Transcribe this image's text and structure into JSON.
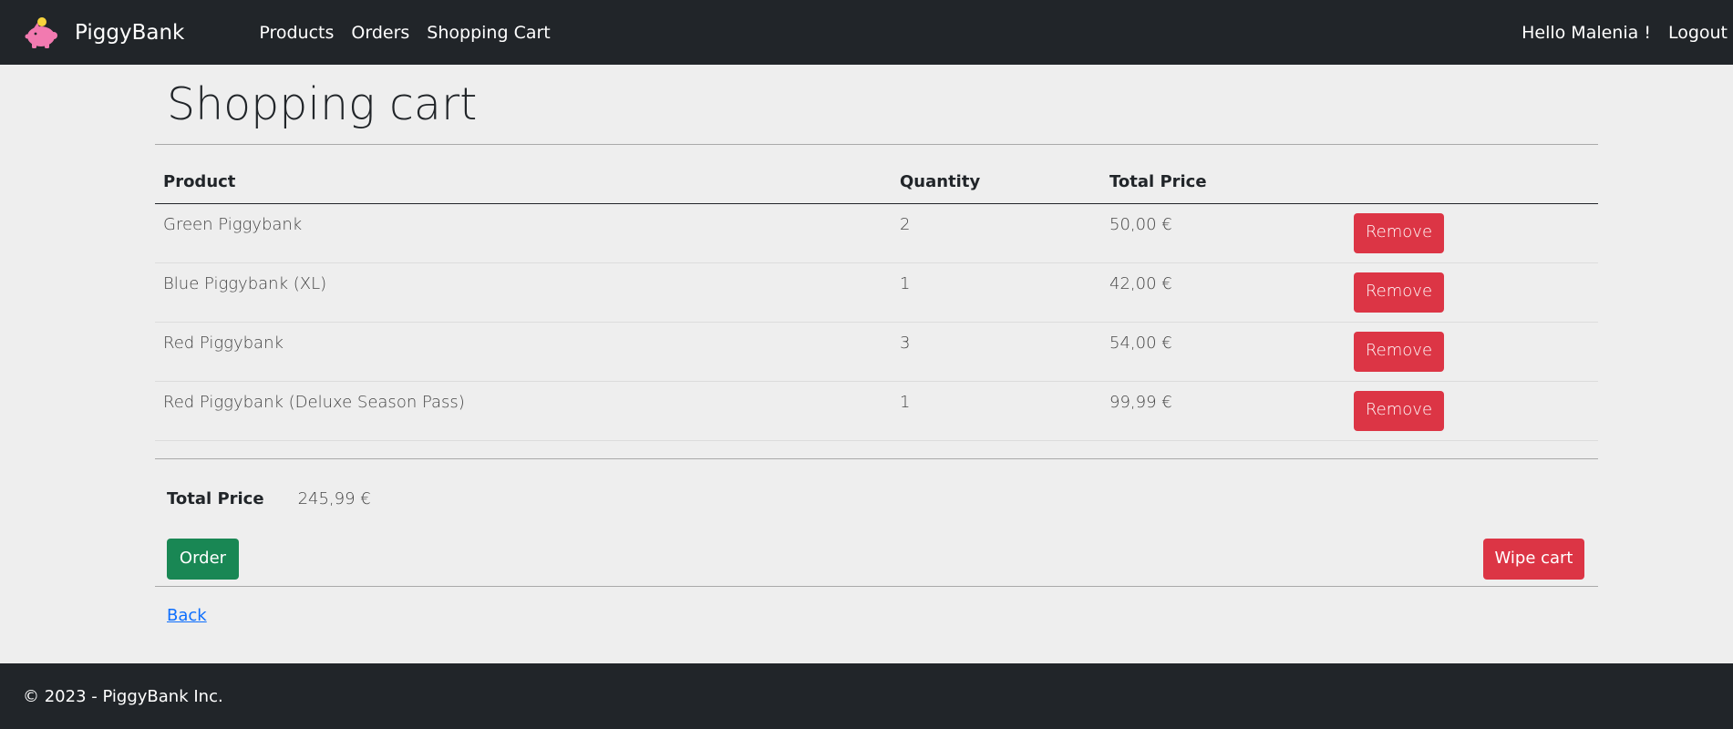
{
  "nav": {
    "brand": "PiggyBank",
    "links": [
      "Products",
      "Orders",
      "Shopping Cart"
    ],
    "greeting": "Hello Malenia !",
    "logout": "Logout"
  },
  "page": {
    "title": "Shopping cart"
  },
  "table": {
    "headers": [
      "Product",
      "Quantity",
      "Total Price"
    ],
    "rows": [
      {
        "product": "Green Piggybank",
        "quantity": "2",
        "price": "50,00 €",
        "action": "Remove"
      },
      {
        "product": "Blue Piggybank (XL)",
        "quantity": "1",
        "price": "42,00 €",
        "action": "Remove"
      },
      {
        "product": "Red Piggybank",
        "quantity": "3",
        "price": "54,00 €",
        "action": "Remove"
      },
      {
        "product": "Red Piggybank (Deluxe Season Pass)",
        "quantity": "1",
        "price": "99,99 €",
        "action": "Remove"
      }
    ]
  },
  "summary": {
    "label": "Total Price",
    "value": "245,99 €"
  },
  "buttons": {
    "order": "Order",
    "wipe": "Wipe cart"
  },
  "back": "Back",
  "footer": {
    "text": "© 2023 - PiggyBank Inc."
  },
  "icons": {
    "logo": "piggy-bank-icon"
  },
  "colors": {
    "nav_bg": "#212529",
    "danger": "#dc3545",
    "success": "#198754",
    "link": "#0d6efd",
    "page_bg": "#eeeeee"
  }
}
